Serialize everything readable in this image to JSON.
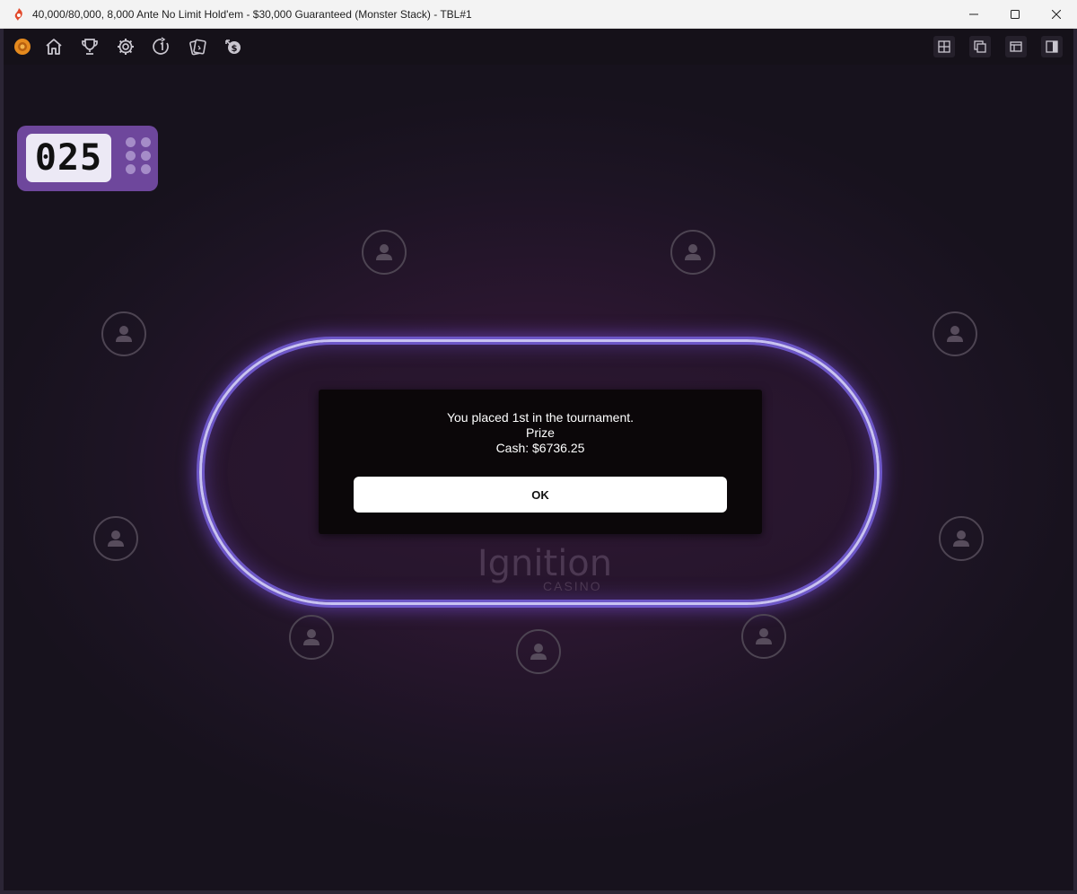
{
  "window": {
    "title": "40,000/80,000, 8,000 Ante No Limit Hold'em - $30,000 Guaranteed (Monster Stack) - TBL#1",
    "controls": [
      "minimize-icon",
      "maximize-icon",
      "close-icon"
    ]
  },
  "toolbar": {
    "left_icons": [
      "chip-logo-icon",
      "home-icon",
      "trophy-icon",
      "gear-icon",
      "timer-icon",
      "cards-icon",
      "cashier-icon"
    ],
    "right_icons": [
      "grid-view-icon",
      "cascade-view-icon",
      "layout-icon",
      "side-panel-icon"
    ]
  },
  "timer": {
    "value": "025"
  },
  "brand": {
    "name": "Ignition",
    "sub": "CASINO"
  },
  "seats": {
    "count": 10,
    "icon": "user-icon"
  },
  "dialog": {
    "line1": "You placed 1st in the tournament.",
    "line2": "Prize",
    "line3": "Cash: $6736.25",
    "ok_label": "OK"
  },
  "colors": {
    "timer_bg": "#6e479c",
    "table_rail": "#c9c3f2",
    "app_icon": "#e2492b"
  }
}
